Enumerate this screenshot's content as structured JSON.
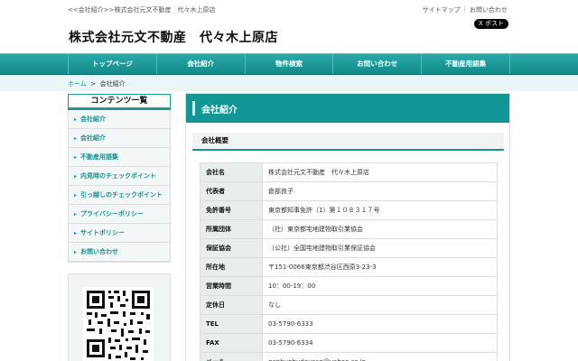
{
  "top": {
    "breadcrumb_text": "<<会社紹介>>株式会社元文不動産　代々木上原店",
    "sitemap": "サイトマップ",
    "separator": "|",
    "contact": "お問い合わせ",
    "x_post": "X ポスト"
  },
  "site_title": "株式会社元文不動産　代々木上原店",
  "gnav": [
    {
      "label": "トップページ"
    },
    {
      "label": "会社紹介"
    },
    {
      "label": "物件検索"
    },
    {
      "label": "お問い合わせ"
    },
    {
      "label": "不動産用語集"
    }
  ],
  "breadcrumb": {
    "home": "ホーム",
    "sep": ">",
    "current": "会社紹介"
  },
  "sidebar": {
    "title": "コンテンツ一覧",
    "items": [
      {
        "label": "会社紹介"
      },
      {
        "label": "会社紹介"
      },
      {
        "label": "不動産用語集"
      },
      {
        "label": "内見時のチェックポイント"
      },
      {
        "label": "引っ越しのチェックポイント"
      },
      {
        "label": "プライバシーポリシー"
      },
      {
        "label": "サイトポリシー"
      },
      {
        "label": "お問い合わせ"
      }
    ]
  },
  "main": {
    "title": "会社紹介",
    "section": "会社概要",
    "rows": [
      {
        "label": "会社名",
        "value": "株式会社元文不動産　代々木上原店"
      },
      {
        "label": "代表者",
        "value": "倉部良子"
      },
      {
        "label": "免許番号",
        "value": "東京都知事免許（1）第１０８３１７号"
      },
      {
        "label": "所属団体",
        "value": "（社）東京都宅地建物取引業協会"
      },
      {
        "label": "保証協会",
        "value": "（公社）全国宅地建物取引業保証協会"
      },
      {
        "label": "所在地",
        "value": "〒151-0066東京都渋谷区西原3-23-3"
      },
      {
        "label": "営業時間",
        "value": "10：00-19：00"
      },
      {
        "label": "定休日",
        "value": "なし"
      },
      {
        "label": "TEL",
        "value": "03-5790-6333"
      },
      {
        "label": "FAX",
        "value": "03-5790-6334"
      },
      {
        "label": "メール",
        "value": "genbunhudousan@yahoo.co.jp"
      }
    ]
  }
}
